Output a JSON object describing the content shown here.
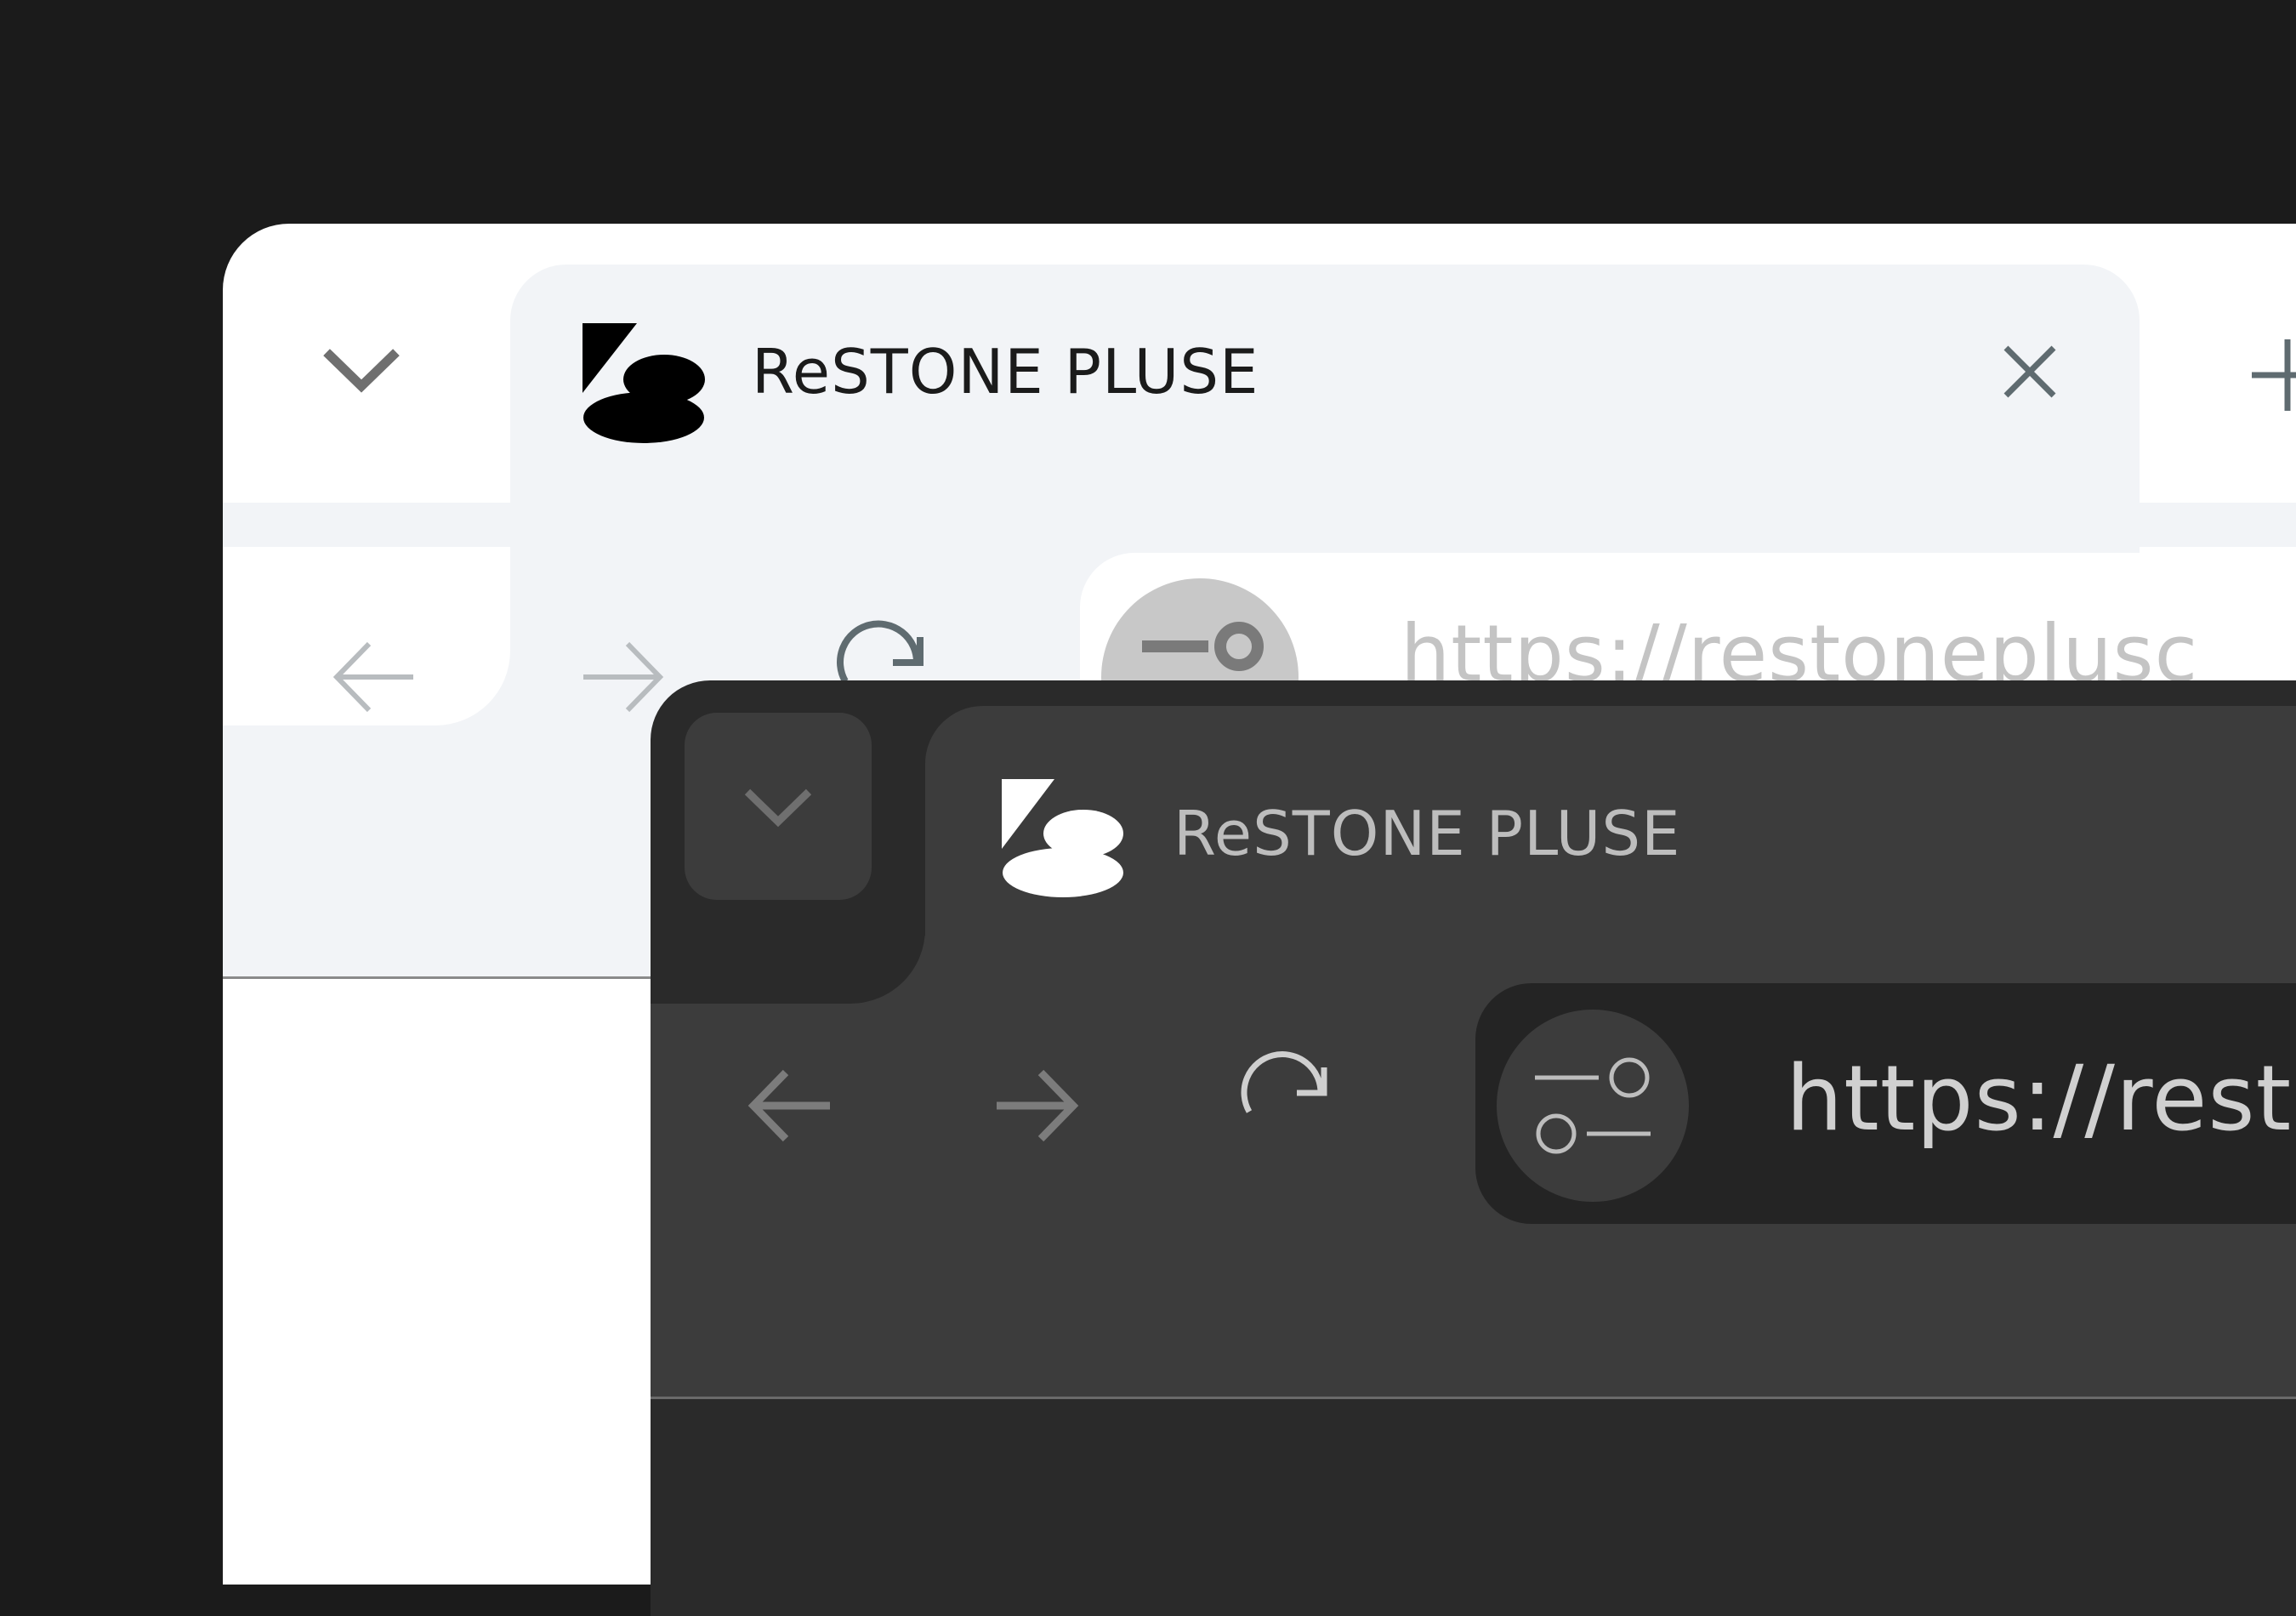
{
  "light_browser": {
    "tab": {
      "title": "ReSTONE PLUSE"
    },
    "address_bar": {
      "url": "https://restoneplusc"
    }
  },
  "dark_browser": {
    "tab": {
      "title": "ReSTONE PLUSE"
    },
    "address_bar": {
      "url": "https://rest"
    }
  },
  "icons": {
    "tab_list": "chevron-down-icon",
    "close_tab": "close-icon",
    "new_tab": "plus-icon",
    "back": "arrow-left-icon",
    "forward": "arrow-right-icon",
    "reload": "reload-icon",
    "site_settings": "tune-icon",
    "favicon": "restone-logo-icon"
  },
  "colors": {
    "background": "#1b1b1b",
    "light_tab": "#f2f4f7",
    "light_window": "#ffffff",
    "dark_tab": "#3c3c3c",
    "dark_window": "#2a2a2a",
    "dark_urlbar": "#242424"
  }
}
